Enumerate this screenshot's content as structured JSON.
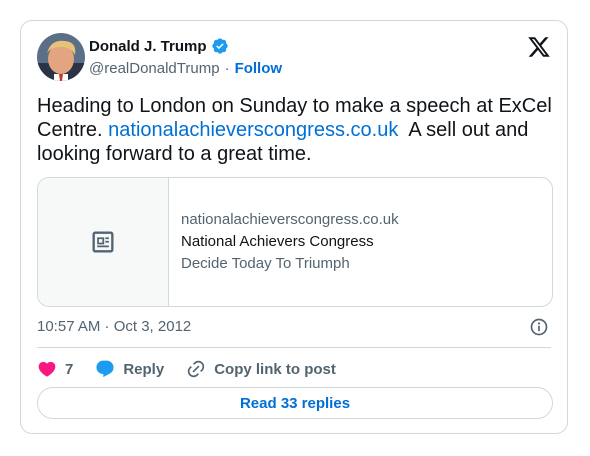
{
  "author": {
    "display_name": "Donald J. Trump",
    "handle": "@realDonaldTrump",
    "verified": true,
    "follow_label": "Follow"
  },
  "tweet": {
    "text_before_link": "Heading to London on Sunday to make a speech at ExCel Centre. ",
    "link_text": "nationalachieverscongress.co.uk",
    "text_after_link": "  A sell out and looking forward to a great time."
  },
  "link_card": {
    "domain": "nationalachieverscongress.co.uk",
    "title": "National Achievers Congress",
    "description": "Decide Today To Triumph",
    "thumbnail_icon": "article-icon"
  },
  "meta": {
    "timestamp": "10:57 AM · Oct 3, 2012"
  },
  "actions": {
    "like_count": "7",
    "reply_label": "Reply",
    "copy_label": "Copy link to post"
  },
  "read_replies_label": "Read 33 replies",
  "colors": {
    "accent": "#006fd6",
    "like": "#f91880",
    "verified": "#1d9bf0",
    "border": "#cfd9de",
    "muted": "#536471"
  }
}
